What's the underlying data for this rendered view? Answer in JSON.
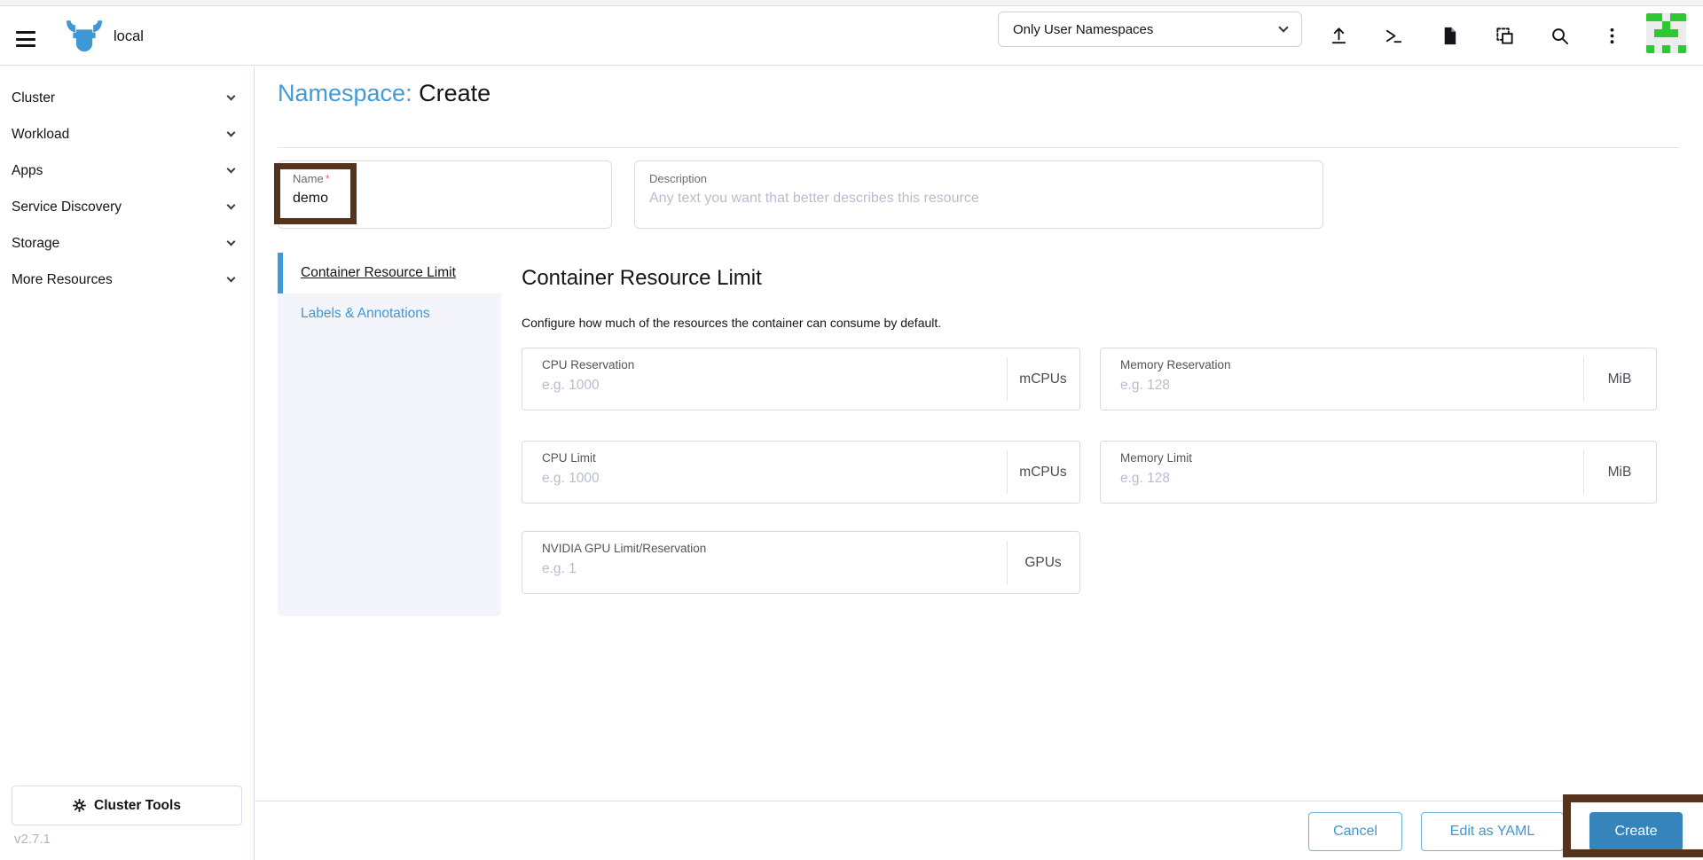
{
  "header": {
    "cluster_name": "local",
    "namespace_dropdown": {
      "value": "Only User Namespaces"
    },
    "icons": [
      "upload-icon",
      "shell-icon",
      "docs-icon",
      "import-icon",
      "search-icon",
      "kebab-menu-icon"
    ],
    "avatar": {
      "color": "#30c734",
      "background": "#ececec",
      "pattern": [
        1,
        1,
        0,
        1,
        1,
        0,
        0,
        1,
        0,
        0,
        0,
        1,
        1,
        1,
        0,
        0,
        0,
        0,
        0,
        0,
        1,
        0,
        1,
        0,
        1
      ]
    }
  },
  "sidebar": {
    "items": [
      {
        "label": "Cluster"
      },
      {
        "label": "Workload"
      },
      {
        "label": "Apps"
      },
      {
        "label": "Service Discovery"
      },
      {
        "label": "Storage"
      },
      {
        "label": "More Resources"
      }
    ],
    "cluster_tools_label": "Cluster Tools",
    "version": "v2.7.1"
  },
  "page": {
    "resource_type": "Namespace:",
    "action": "Create"
  },
  "form": {
    "name": {
      "label": "Name",
      "required_marker": "*",
      "value": "demo"
    },
    "description": {
      "label": "Description",
      "placeholder": "Any text you want that better describes this resource"
    }
  },
  "tabs": {
    "items": [
      {
        "label": "Container Resource Limit",
        "active": true
      },
      {
        "label": "Labels & Annotations",
        "active": false
      }
    ]
  },
  "section": {
    "heading": "Container Resource Limit",
    "subtitle": "Configure how much of the resources the container can consume by default.",
    "fields": [
      {
        "label": "CPU Reservation",
        "placeholder": "e.g. 1000",
        "unit": "mCPUs"
      },
      {
        "label": "Memory Reservation",
        "placeholder": "e.g. 128",
        "unit": "MiB"
      },
      {
        "label": "CPU Limit",
        "placeholder": "e.g. 1000",
        "unit": "mCPUs"
      },
      {
        "label": "Memory Limit",
        "placeholder": "e.g. 128",
        "unit": "MiB"
      },
      {
        "label": "NVIDIA GPU Limit/Reservation",
        "placeholder": "e.g. 1",
        "unit": "GPUs"
      }
    ]
  },
  "footer": {
    "cancel_label": "Cancel",
    "edit_yaml_label": "Edit as YAML",
    "create_label": "Create"
  },
  "colors": {
    "accent": "#3d98d3",
    "annotation": "#55341e"
  }
}
